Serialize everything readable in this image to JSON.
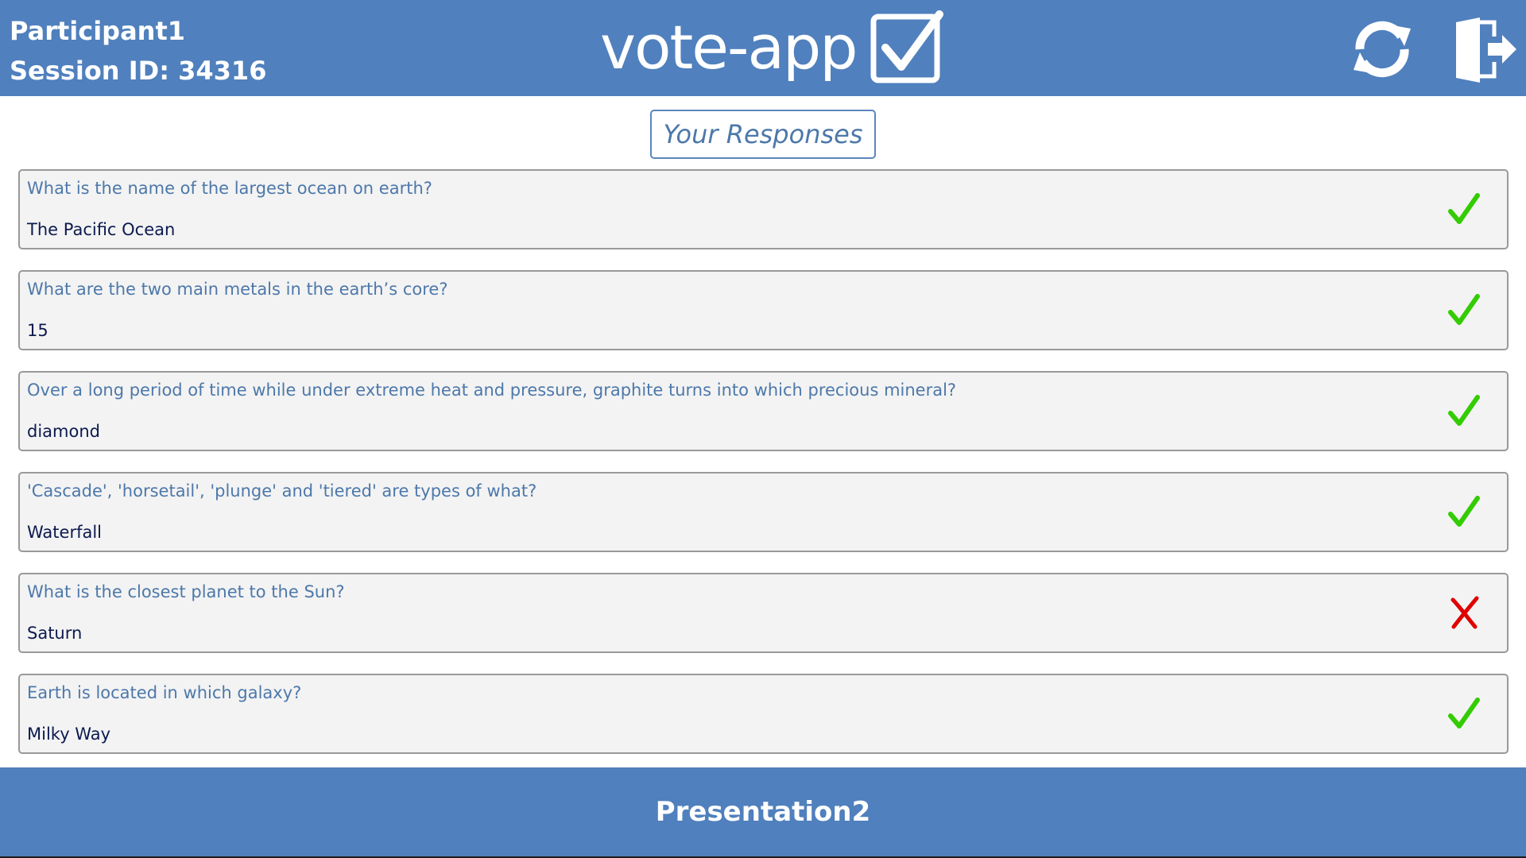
{
  "header": {
    "participant": "Participant1",
    "session": "Session ID: 34316",
    "logo_text": "vote-app",
    "logo_icon": "checkbox-checked-icon",
    "refresh_icon": "refresh-icon",
    "logout_icon": "logout-icon"
  },
  "main": {
    "title": "Your Responses",
    "responses": [
      {
        "question": "What is the name of the largest ocean on earth?",
        "answer": "The Pacific Ocean",
        "status": "correct"
      },
      {
        "question": "What are the two main metals in the earth’s core?",
        "answer": "15",
        "status": "correct"
      },
      {
        "question": "Over a long period of time while under extreme heat and pressure, graphite turns into which precious mineral?",
        "answer": "diamond",
        "status": "correct"
      },
      {
        "question": "'Cascade', 'horsetail', 'plunge' and 'tiered' are types of what?",
        "answer": "Waterfall",
        "status": "correct"
      },
      {
        "question": " What is the closest planet to the Sun?",
        "answer": "Saturn",
        "status": "incorrect"
      },
      {
        "question": "Earth is located in which galaxy?",
        "answer": "Milky Way",
        "status": "correct"
      }
    ]
  },
  "footer": {
    "presentation": "Presentation2"
  },
  "colors": {
    "brand": "#5080bd",
    "question_text": "#4d78aa",
    "answer_text": "#0c1a4f",
    "correct": "#33cc00",
    "incorrect": "#e00000",
    "card_bg": "#f3f3f3"
  }
}
